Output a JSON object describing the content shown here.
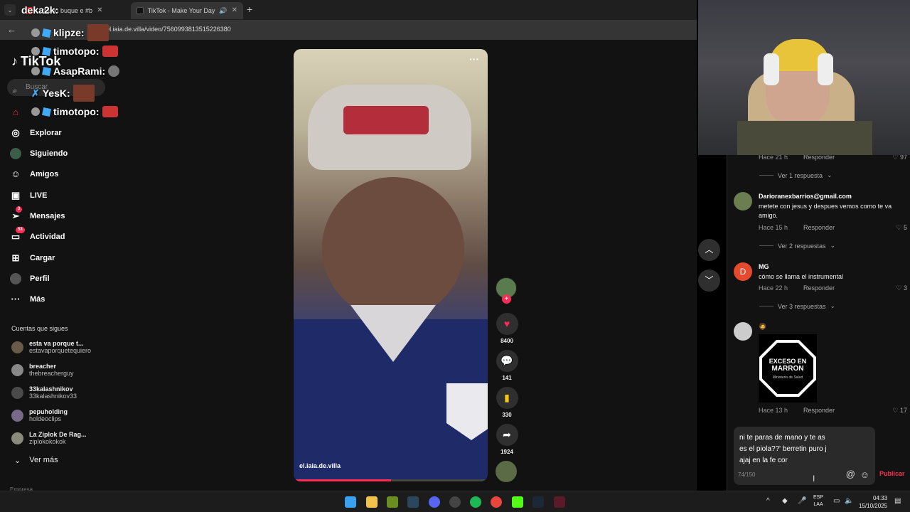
{
  "browser": {
    "tabs": [
      {
        "label": "...tra un buque e #b",
        "active": false,
        "color": "#e02020"
      },
      {
        "label": "TikTok - Make Your Day",
        "active": true,
        "color": "#111111"
      }
    ],
    "new_tab": "+",
    "url": "@el.iaia.de.villa/video/7560993813515226380"
  },
  "chat": [
    {
      "user": "deka2k:"
    },
    {
      "user": "klipze:"
    },
    {
      "user": "timotopo:"
    },
    {
      "user": "AsapRami:"
    },
    {
      "user": "YesK:"
    },
    {
      "user": "timotopo:"
    }
  ],
  "sidebar": {
    "logo": "TikTok",
    "search_placeholder": "Buscar",
    "nav": [
      {
        "label": "Explorar",
        "icon": "compass-icon"
      },
      {
        "label": "Siguiendo",
        "icon": "following-icon"
      },
      {
        "label": "Amigos",
        "icon": "friends-icon"
      },
      {
        "label": "LIVE",
        "icon": "live-icon"
      },
      {
        "label": "Mensajes",
        "icon": "messages-icon",
        "badge": "3"
      },
      {
        "label": "Actividad",
        "icon": "activity-icon",
        "badge": "53"
      },
      {
        "label": "Cargar",
        "icon": "upload-icon"
      },
      {
        "label": "Perfil",
        "icon": "profile-icon"
      },
      {
        "label": "Más",
        "icon": "more-icon"
      }
    ],
    "following_title": "Cuentas que sigues",
    "following": [
      {
        "name": "esta va porque t...",
        "handle": "estavaporquetequiero"
      },
      {
        "name": "breacher",
        "handle": "thebreacherguy"
      },
      {
        "name": "33kalashnikov",
        "handle": "33kalashnikov33"
      },
      {
        "name": "pepuholding",
        "handle": "holdeoclips"
      },
      {
        "name": "La Ziplok De Rag...",
        "handle": "ziplokokokok"
      }
    ],
    "see_more": "Ver más",
    "footer": "Empresa"
  },
  "video": {
    "author": "el.iaia.de.villa",
    "more": "···",
    "progress": 0.5,
    "likes": "8400",
    "comments": "141",
    "saves": "330",
    "shares": "1924"
  },
  "comments": {
    "items": [
      {
        "name": "",
        "text": "",
        "time": "Hace 21 h",
        "reply": "Responder",
        "likes": "97",
        "view_replies": "Ver 1 respuesta"
      },
      {
        "name": "Darioranexbarrios@gmail.com",
        "text": "metete con jesus y despues vemos como te va amigo.",
        "time": "Hace 15 h",
        "reply": "Responder",
        "likes": "5",
        "view_replies": "Ver 2 respuestas"
      },
      {
        "name": "MG",
        "avatar_letter": "D",
        "text": "cómo se llama el instrumental",
        "time": "Hace 22 h",
        "reply": "Responder",
        "likes": "3",
        "view_replies": "Ver 3 respuestas"
      },
      {
        "name": "",
        "text": "",
        "time": "Hace 13 h",
        "reply": "Responder",
        "likes": "17"
      }
    ],
    "sticker": {
      "line1": "EXCESO EN",
      "line2": "MARRON",
      "line3": "Ministerio de Salud"
    },
    "draft": "ni te paras de mano y te as\nes el piola??' berretin puro j\najaj en la fe cor",
    "char_count": "74/150",
    "publish": "Publicar"
  },
  "taskbar": {
    "lang": "ESP\nLAA",
    "time": "04:33",
    "date": "15/10/2025"
  },
  "colors": {
    "accent": "#fe2c55",
    "bg": "#121212"
  }
}
